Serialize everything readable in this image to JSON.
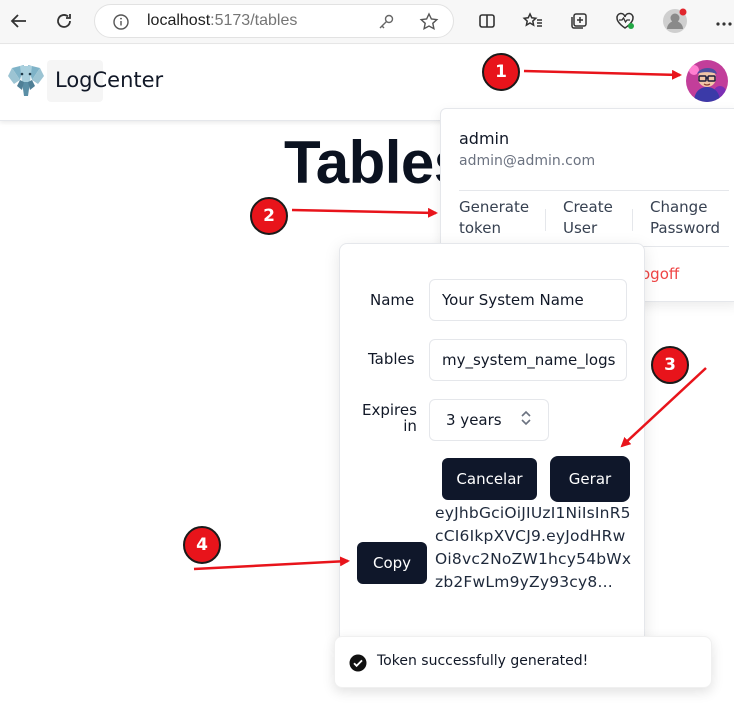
{
  "browser": {
    "url_host": "localhost",
    "url_rest": ":5173/tables"
  },
  "app": {
    "brand": "LogCenter",
    "page_title": "Tables"
  },
  "account_menu": {
    "name": "admin",
    "email": "admin@admin.com",
    "actions": [
      {
        "line1": "Generate",
        "line2": "token"
      },
      {
        "line1": "Create",
        "line2": "User"
      },
      {
        "line1": "Change",
        "line2": "Password"
      }
    ],
    "logoff_visible": "ogoff"
  },
  "token_dialog": {
    "name_label": "Name",
    "name_value": "Your System Name",
    "tables_label": "Tables",
    "tables_value": "my_system_name_logs",
    "expires_label_1": "Expires",
    "expires_label_2": "in",
    "expires_value": "3 years",
    "cancel_label": "Cancelar",
    "generate_label": "Gerar",
    "copy_label": "Copy",
    "token_text": "eyJhbGciOiJIUzI1NiIsInR5cCI6IkpXVCJ9.eyJodHRwOi8vc2NoZW1hcy54bWxzb2FwLm9yZy93cy8..."
  },
  "toast": {
    "message": "Token successfully generated!"
  },
  "callouts": [
    "1",
    "2",
    "3",
    "4"
  ],
  "colors": {
    "callout": "#e8141b",
    "button_dark": "#0f172a",
    "logoff": "#ef4444",
    "arrow": "#e8141b"
  }
}
